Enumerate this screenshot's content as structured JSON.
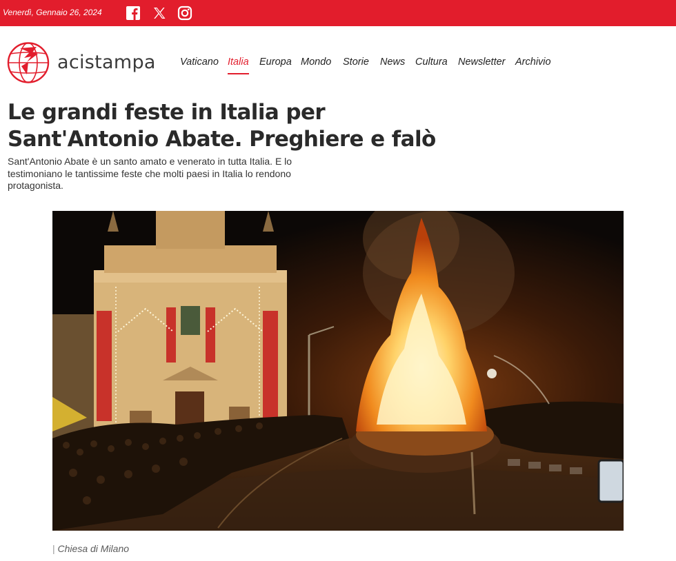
{
  "topbar": {
    "date": "Venerdì, Gennaio 26, 2024",
    "background_color": "#e21d2c",
    "social_icons": [
      "facebook-icon",
      "x-icon",
      "instagram-icon"
    ]
  },
  "brand": {
    "name": "acistampa",
    "accent_color": "#e21d2c"
  },
  "nav": {
    "items": [
      {
        "label": "Vaticano",
        "active": false
      },
      {
        "label": "Italia",
        "active": true
      },
      {
        "label": "Europa",
        "active": false
      },
      {
        "label": "Mondo",
        "active": false
      },
      {
        "label": "Storie",
        "active": false
      },
      {
        "label": "News",
        "active": false
      },
      {
        "label": "Cultura",
        "active": false
      },
      {
        "label": "Newsletter",
        "active": false
      },
      {
        "label": "Archivio",
        "active": false
      }
    ]
  },
  "article": {
    "title": "Le grandi feste in Italia per Sant'Antonio Abate. Preghiere e falò",
    "lead": "Sant'Antonio Abate è un santo amato e venerato in tutta Italia. E lo testimoniano le tantissime feste che molti paesi in Italia lo rendono protagonista.",
    "image_caption_separator": "|",
    "image_caption": "Chiesa di Milano"
  }
}
